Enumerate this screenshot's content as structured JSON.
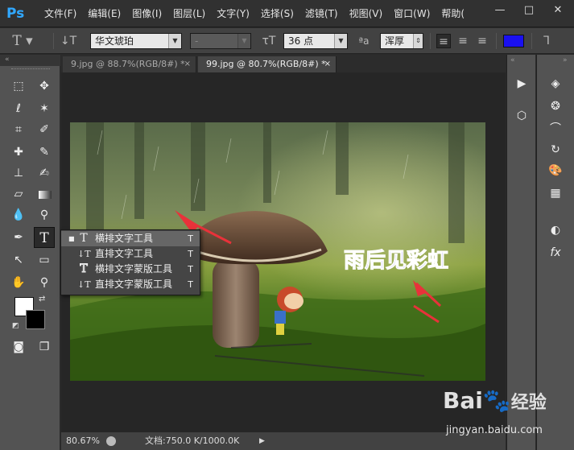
{
  "app": {
    "logo": "Ps"
  },
  "menu": [
    "文件(F)",
    "编辑(E)",
    "图像(I)",
    "图层(L)",
    "文字(Y)",
    "选择(S)",
    "滤镜(T)",
    "视图(V)",
    "窗口(W)",
    "帮助("
  ],
  "window_controls": {
    "minimize": "—",
    "maximize": "□",
    "close": "✕"
  },
  "options": {
    "font_family": "华文琥珀",
    "font_style": "-",
    "font_size": "36 点",
    "antialias": "浑厚",
    "aa_label": "ªa",
    "text_color": "#1a10f0"
  },
  "tabs": [
    {
      "label": "9.jpg @ 88.7%(RGB/8#) *",
      "close": "×",
      "active": false
    },
    {
      "label": "99.jpg @ 80.7%(RGB/8#) *",
      "close": "×",
      "active": true
    }
  ],
  "canvas_text": "雨后见彩虹",
  "flyout": [
    {
      "icon": "T",
      "label": "横排文字工具",
      "key": "T",
      "selected": true
    },
    {
      "icon": "↓T",
      "label": "直排文字工具",
      "key": "T",
      "selected": false
    },
    {
      "icon": "T",
      "label": "横排文字蒙版工具",
      "key": "T",
      "selected": false
    },
    {
      "icon": "↓T",
      "label": "直排文字蒙版工具",
      "key": "T",
      "selected": false
    }
  ],
  "status": {
    "zoom": "80.67%",
    "doc": "文档:750.0 K/1000.0K"
  },
  "watermark": {
    "brand": "Bai",
    "brand2": "经验",
    "url": "jingyan.baidu.com"
  },
  "colors": {
    "foreground": "#ffffff",
    "background": "#000000",
    "accent_arrow": "#e8323a"
  }
}
